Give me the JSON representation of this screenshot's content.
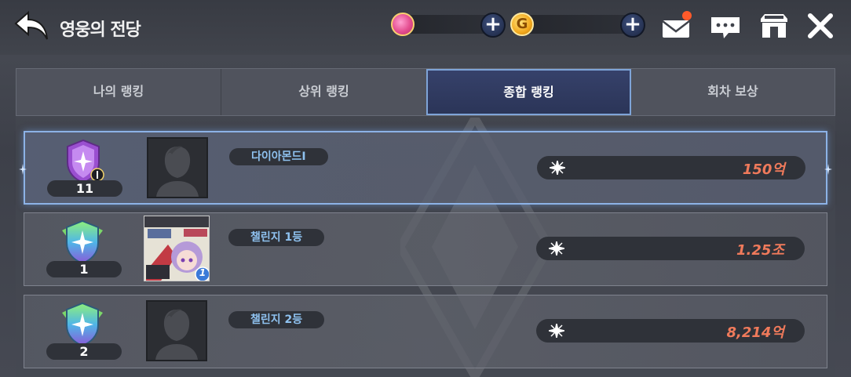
{
  "header": {
    "title": "영웅의 전당",
    "gold_symbol": "G"
  },
  "tabs": [
    {
      "label": "나의 랭킹"
    },
    {
      "label": "상위 랭킹"
    },
    {
      "label": "종합 랭킹"
    },
    {
      "label": "회차 보상"
    }
  ],
  "active_tab": "종합 랭킹",
  "rows": [
    {
      "rank": "11",
      "name": "다이아몬드I",
      "score": "150억",
      "tier": "diamond",
      "highlighted": true,
      "has_portrait": false
    },
    {
      "rank": "1",
      "name": "챌린지 1등",
      "score": "1.25조",
      "tier": "challenge",
      "highlighted": false,
      "has_portrait": true,
      "portrait_badge": "1"
    },
    {
      "rank": "2",
      "name": "챌린지 2등",
      "score": "8,214억",
      "tier": "challenge",
      "highlighted": false,
      "has_portrait": false
    }
  ],
  "colors": {
    "active_tab_border": "#7ea4d8",
    "score_text": "#f07a5b",
    "name_text": "#8fc2f0"
  }
}
